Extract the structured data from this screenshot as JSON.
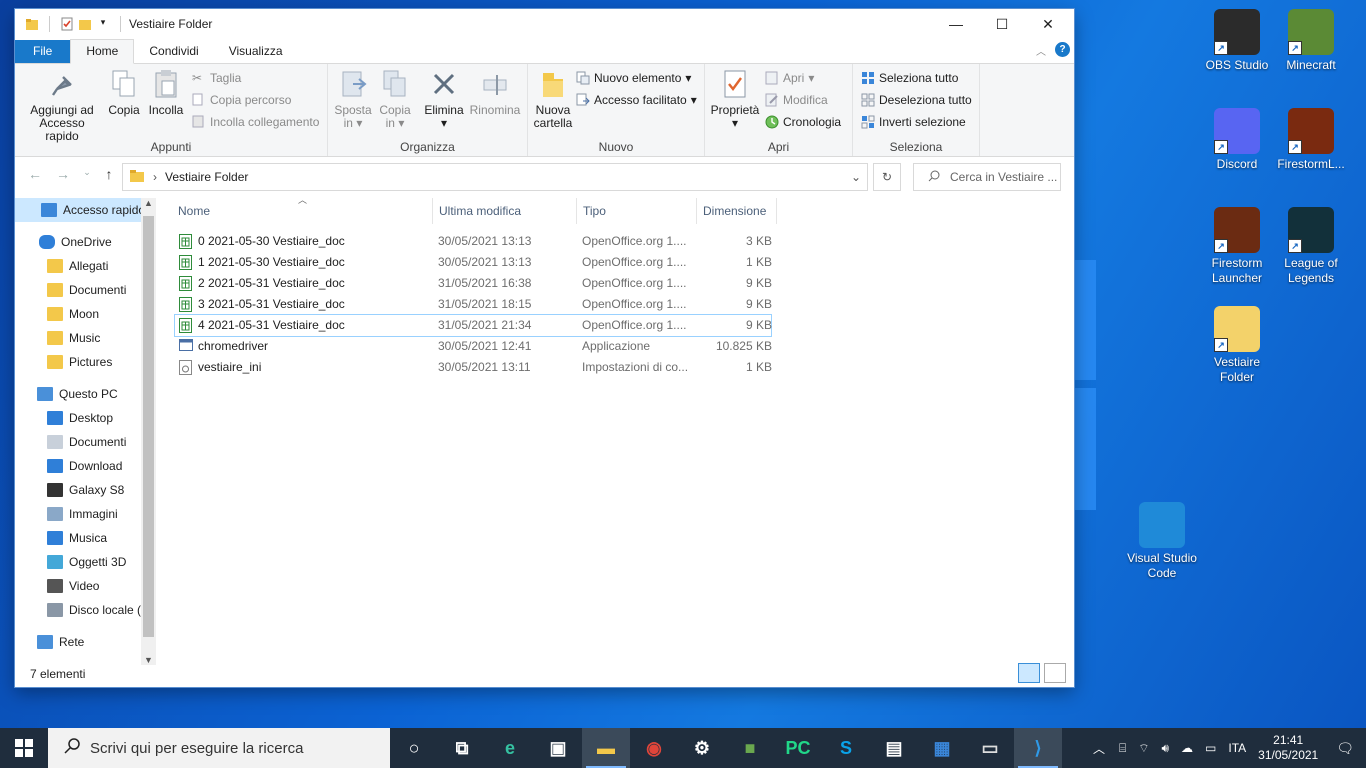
{
  "window": {
    "title": "Vestiaire Folder",
    "controls": {
      "minimize": "—",
      "maximize": "☐",
      "close": "✕"
    }
  },
  "ribbon_tabs": [
    "File",
    "Home",
    "Condividi",
    "Visualizza"
  ],
  "ribbon": {
    "appunti": {
      "label": "Appunti",
      "pin_line1": "Aggiungi ad",
      "pin_line2": "Accesso rapido",
      "copy": "Copia",
      "paste": "Incolla",
      "cut": "Taglia",
      "copy_path": "Copia percorso",
      "paste_link": "Incolla collegamento"
    },
    "organizza": {
      "label": "Organizza",
      "move_line1": "Sposta",
      "move_line2": "in",
      "copyto_line1": "Copia",
      "copyto_line2": "in",
      "delete": "Elimina",
      "rename": "Rinomina"
    },
    "nuovo": {
      "label": "Nuovo",
      "new_folder_line1": "Nuova",
      "new_folder_line2": "cartella",
      "new_item": "Nuovo elemento",
      "easy_access": "Accesso facilitato"
    },
    "apri": {
      "label": "Apri",
      "properties": "Proprietà",
      "open": "Apri",
      "edit": "Modifica",
      "history": "Cronologia"
    },
    "seleziona": {
      "label": "Seleziona",
      "select_all": "Seleziona tutto",
      "select_none": "Deseleziona tutto",
      "invert": "Inverti selezione"
    }
  },
  "address": {
    "path": "Vestiaire Folder",
    "search_placeholder": "Cerca in Vestiaire ..."
  },
  "nav_items": [
    {
      "label": "Accesso rapido",
      "icon": "star-icon"
    },
    {
      "label": "OneDrive",
      "icon": "cloud-icon"
    },
    {
      "label": "Allegati",
      "icon": "folder-icon"
    },
    {
      "label": "Documenti",
      "icon": "folder-icon"
    },
    {
      "label": "Moon",
      "icon": "folder-icon"
    },
    {
      "label": "Music",
      "icon": "folder-icon"
    },
    {
      "label": "Pictures",
      "icon": "folder-icon"
    },
    {
      "label": "Questo PC",
      "icon": "computer-icon"
    },
    {
      "label": "Desktop",
      "icon": "desktop-icon"
    },
    {
      "label": "Documenti",
      "icon": "documents-icon"
    },
    {
      "label": "Download",
      "icon": "download-icon"
    },
    {
      "label": "Galaxy S8",
      "icon": "phone-icon"
    },
    {
      "label": "Immagini",
      "icon": "pictures-icon"
    },
    {
      "label": "Musica",
      "icon": "music-icon"
    },
    {
      "label": "Oggetti 3D",
      "icon": "cube-icon"
    },
    {
      "label": "Video",
      "icon": "video-icon"
    },
    {
      "label": "Disco locale (",
      "icon": "drive-icon"
    },
    {
      "label": "Rete",
      "icon": "network-icon"
    }
  ],
  "columns": [
    "Nome",
    "Ultima modifica",
    "Tipo",
    "Dimensione"
  ],
  "files": [
    {
      "name": "0  2021-05-30 Vestiaire_doc",
      "modified": "30/05/2021 13:13",
      "type": "OpenOffice.org 1....",
      "size": "3 KB",
      "icon": "spreadsheet-icon"
    },
    {
      "name": "1  2021-05-30 Vestiaire_doc",
      "modified": "30/05/2021 13:13",
      "type": "OpenOffice.org 1....",
      "size": "1 KB",
      "icon": "spreadsheet-icon"
    },
    {
      "name": "2  2021-05-31 Vestiaire_doc",
      "modified": "31/05/2021 16:38",
      "type": "OpenOffice.org 1....",
      "size": "9 KB",
      "icon": "spreadsheet-icon"
    },
    {
      "name": "3  2021-05-31 Vestiaire_doc",
      "modified": "31/05/2021 18:15",
      "type": "OpenOffice.org 1....",
      "size": "9 KB",
      "icon": "spreadsheet-icon"
    },
    {
      "name": "4  2021-05-31 Vestiaire_doc",
      "modified": "31/05/2021 21:34",
      "type": "OpenOffice.org 1....",
      "size": "9 KB",
      "icon": "spreadsheet-icon"
    },
    {
      "name": "chromedriver",
      "modified": "30/05/2021 12:41",
      "type": "Applicazione",
      "size": "10.825 KB",
      "icon": "app-icon"
    },
    {
      "name": "vestiaire_ini",
      "modified": "30/05/2021 13:11",
      "type": "Impostazioni di co...",
      "size": "1 KB",
      "icon": "settings-file-icon"
    }
  ],
  "status": "7 elementi",
  "desktop_icons": [
    {
      "label1": "OBS Studio",
      "label2": "",
      "icon": "obs-icon",
      "color": "#2b2b2b"
    },
    {
      "label1": "Minecraft",
      "label2": "",
      "icon": "minecraft-icon",
      "color": "#5b8a35"
    },
    {
      "label1": "Discord",
      "label2": "",
      "icon": "discord-icon",
      "color": "#5865f2"
    },
    {
      "label1": "FirestormL...",
      "label2": "",
      "icon": "firestorm-icon",
      "color": "#7a2a10"
    },
    {
      "label1": "Firestorm",
      "label2": "Launcher",
      "icon": "firestorm-launcher-icon",
      "color": "#6b2b12"
    },
    {
      "label1": "League of",
      "label2": "Legends",
      "icon": "league-icon",
      "color": "#12303a"
    },
    {
      "label1": "Vestiaire",
      "label2": "Folder",
      "icon": "folder-icon",
      "color": "#f3d26a"
    },
    {
      "label1": "Visual Studio",
      "label2": "Code",
      "icon": "vscode-icon",
      "color": "#1f8ad8"
    }
  ],
  "taskbar": {
    "search_placeholder": "Scrivi qui per eseguire la ricerca",
    "apps": [
      "task-view-icon",
      "timeline-icon",
      "edge-icon",
      "store-icon",
      "file-explorer-icon",
      "chrome-icon",
      "settings-icon",
      "minecraft-icon",
      "pycharm-icon",
      "skype-icon",
      "notepad-icon",
      "calendar-icon",
      "rdp-icon",
      "vscode-icon"
    ],
    "language": "ITA",
    "time": "21:41",
    "date": "31/05/2021"
  }
}
